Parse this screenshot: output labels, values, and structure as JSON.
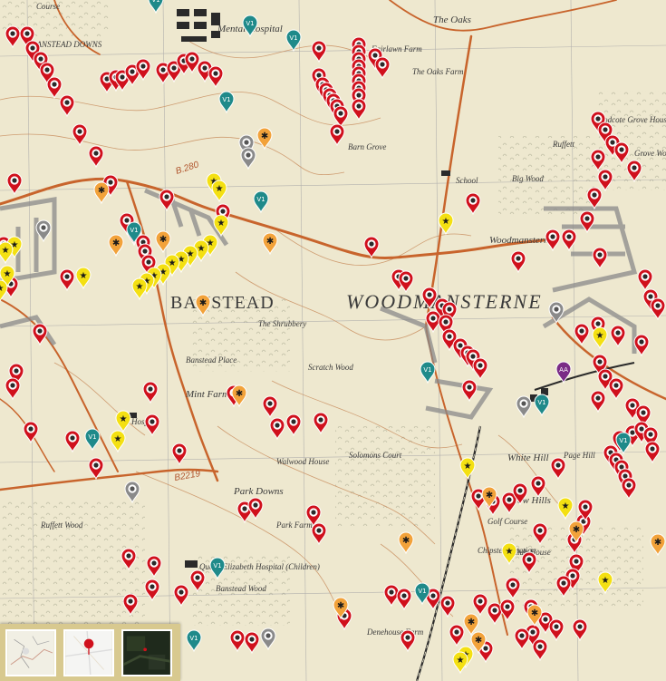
{
  "map": {
    "places": [
      {
        "id": "course",
        "text": "Course",
        "cls": "place-small"
      },
      {
        "id": "banstead-downs",
        "text": "BANSTEAD DOWNS",
        "cls": "place-small"
      },
      {
        "id": "mental-hospital",
        "text": "Mental Hospital",
        "cls": "place-mid"
      },
      {
        "id": "the-oaks",
        "text": "The Oaks",
        "cls": "place-mid"
      },
      {
        "id": "fairlawn-farm",
        "text": "Fairlawn Farm",
        "cls": "place-small"
      },
      {
        "id": "the-oaks-farm",
        "text": "The Oaks Farm",
        "cls": "place-small"
      },
      {
        "id": "barn-grove",
        "text": "Barn Grove",
        "cls": "place-small"
      },
      {
        "id": "school",
        "text": "School",
        "cls": "place-small"
      },
      {
        "id": "big-wood",
        "text": "Big Wood",
        "cls": "place-small"
      },
      {
        "id": "ruffett",
        "text": "Ruffett",
        "cls": "place-small"
      },
      {
        "id": "woodcote-grove-house",
        "text": "Woodcote Grove House",
        "cls": "place-small"
      },
      {
        "id": "grove-wood",
        "text": "Grove Wood",
        "cls": "place-small"
      },
      {
        "id": "woodmansterne-small",
        "text": "Woodmansterne",
        "cls": "place-mid"
      },
      {
        "id": "banstead",
        "text": "BANSTEAD",
        "cls": "place-big"
      },
      {
        "id": "woodmansterne",
        "text": "WOODMANSTERNE",
        "cls": "place-huge"
      },
      {
        "id": "the-shrubbery",
        "text": "The Shrubbery",
        "cls": "place-small"
      },
      {
        "id": "scratch-wood",
        "text": "Scratch Wood",
        "cls": "place-small"
      },
      {
        "id": "banstead-place",
        "text": "Banstead Place",
        "cls": "place-small"
      },
      {
        "id": "mint-farm",
        "text": "Mint Farm",
        "cls": "place-mid"
      },
      {
        "id": "hospital",
        "text": "Hospital",
        "cls": "place-small"
      },
      {
        "id": "walwood-house",
        "text": "Walwood House",
        "cls": "place-small"
      },
      {
        "id": "solomons-court",
        "text": "Solomons Court",
        "cls": "place-small"
      },
      {
        "id": "park-downs",
        "text": "Park Downs",
        "cls": "place-mid"
      },
      {
        "id": "ruffett-wood",
        "text": "Ruffett Wood",
        "cls": "place-small"
      },
      {
        "id": "park-farm",
        "text": "Park Farm",
        "cls": "place-small"
      },
      {
        "id": "white-hill",
        "text": "White Hill",
        "cls": "place-mid"
      },
      {
        "id": "how-hills",
        "text": "How Hills",
        "cls": "place-mid"
      },
      {
        "id": "page-hill",
        "text": "Page Hill",
        "cls": "place-small"
      },
      {
        "id": "gold-course",
        "text": "Golf Course",
        "cls": "place-small"
      },
      {
        "id": "chipstead-station",
        "text": "Chipstead Station",
        "cls": "place-small"
      },
      {
        "id": "club-house",
        "text": "Club House",
        "cls": "place-small"
      },
      {
        "id": "queen-elizabeth",
        "text": "Queen Elizabeth Hospital (Children)",
        "cls": "place-small"
      },
      {
        "id": "banstead-wood",
        "text": "Banstead Wood",
        "cls": "place-small"
      },
      {
        "id": "denehouse-farm",
        "text": "Denehouse Farm",
        "cls": "place-small"
      }
    ],
    "roads": [
      {
        "id": "b280",
        "text": "B.280"
      },
      {
        "id": "b2219",
        "text": "B2219"
      }
    ],
    "marker_labels": {
      "v1": "V1",
      "aa": "AA"
    },
    "colors": {
      "red_pin": "#d0101c",
      "yellow_pin": "#f4e012",
      "orange_pin": "#f2a23a",
      "teal_pin": "#1f8a8a",
      "grey_pin": "#8a8a8a",
      "purple_pin": "#7a2b86",
      "road": "#c8642c",
      "contour": "#c78a5a",
      "grid": "#9a9aa0",
      "map_bg": "#eee8cf"
    },
    "basemaps": [
      {
        "id": "os-map",
        "name": "os-map-thumb"
      },
      {
        "id": "street-map",
        "name": "street-map-thumb"
      },
      {
        "id": "satellite",
        "name": "satellite-thumb"
      }
    ]
  }
}
